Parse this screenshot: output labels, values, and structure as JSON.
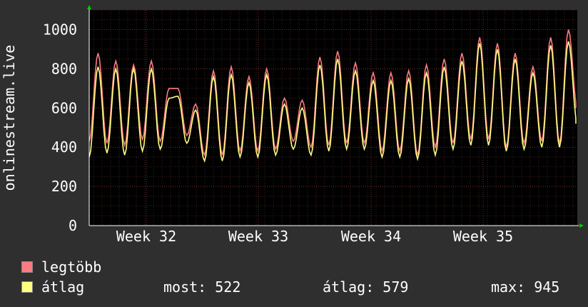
{
  "chart_data": {
    "type": "line",
    "ylabel": "onlinestream.live",
    "ylim": [
      0,
      1100
    ],
    "yticks": [
      0,
      200,
      400,
      600,
      800,
      1000
    ],
    "xticks": [
      "Week 32",
      "Week 33",
      "Week 34",
      "Week 35"
    ],
    "grid": true,
    "series": [
      {
        "name": "legtöbb",
        "color": "#ff7a82",
        "values": [
          430,
          880,
          420,
          840,
          410,
          820,
          440,
          840,
          430,
          700,
          700,
          460,
          620,
          360,
          790,
          360,
          810,
          380,
          760,
          380,
          800,
          390,
          650,
          430,
          640,
          400,
          860,
          410,
          890,
          420,
          830,
          420,
          780,
          380,
          780,
          380,
          790,
          360,
          820,
          400,
          850,
          420,
          880,
          440,
          960,
          440,
          930,
          400,
          880,
          420,
          810,
          430,
          960,
          420,
          1000,
          600
        ]
      },
      {
        "name": "átlag",
        "color": "#ffff80",
        "values": [
          350,
          810,
          370,
          800,
          360,
          800,
          380,
          800,
          390,
          650,
          660,
          420,
          590,
          330,
          760,
          330,
          770,
          350,
          730,
          350,
          770,
          360,
          620,
          390,
          600,
          360,
          820,
          380,
          850,
          390,
          790,
          390,
          740,
          350,
          740,
          350,
          750,
          340,
          780,
          360,
          810,
          390,
          840,
          410,
          930,
          410,
          900,
          380,
          850,
          390,
          780,
          400,
          920,
          400,
          940,
          520
        ]
      }
    ],
    "legend": [
      {
        "label": "legtöbb",
        "color": "#ff7a82"
      },
      {
        "label": "átlag",
        "color": "#ffff80"
      }
    ],
    "stats": {
      "now": "most: 522",
      "avg": "átlag: 579",
      "max": "max: 945"
    }
  }
}
